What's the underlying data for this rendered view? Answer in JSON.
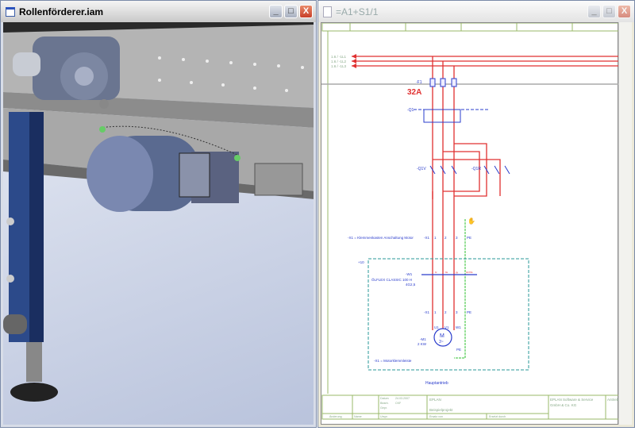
{
  "left_window": {
    "title": "Rollenförderer.iam",
    "buttons": {
      "minimize": "_",
      "maximize": "□",
      "close": "X"
    }
  },
  "right_window": {
    "title": "=A1+S1/1",
    "buttons": {
      "minimize": "_",
      "maximize": "□",
      "close": "X"
    }
  },
  "schematic": {
    "supply": [
      "1.6 / -1L1",
      "1.6 / -1L2",
      "1.6 / -1L3"
    ],
    "fuse_label": "-F1",
    "fuse_rating": "32A",
    "breaker_label": "-Q1",
    "contactor_v": "-Q1V",
    "contactor_r": "-Q1R",
    "terminal_label": "-X1",
    "terminal_desc": "-X1 = Klemmenkasten Anschaltung Motor",
    "terminals": [
      "1",
      "2",
      "3",
      "PE"
    ],
    "location": "+10",
    "cable_label": "-W1",
    "cable_type": "ÖLFLEX CLASSIC 100 H",
    "cable_size": "4G2,5",
    "cable_cores": [
      "br",
      "bk",
      "gy",
      "GNYE"
    ],
    "motor_terminals": [
      "U1",
      "V1",
      "W1",
      "PE"
    ],
    "motor_label": "-M1",
    "motor_power": "2 KW",
    "motor_symbol": "M",
    "motor_phase": "3~",
    "motor_terminal_desc": "-X1 = Motorklemmleiste",
    "caption": "Hauptantrieb"
  },
  "title_block": {
    "datum_label": "Datum",
    "datum": "24.03.2007",
    "bearb_label": "Bearb.",
    "bearb": "CKF",
    "gepr_label": "Gepr.",
    "aenderung": "Änderung",
    "name": "Name",
    "urspr": "Urspr.",
    "company_short": "EPLAN",
    "project": "Beispielprojekt",
    "ersatz": "Ersatz von",
    "ersetzt": "Ersetzt durch",
    "company": "EPLAN Software & Service",
    "company2": "GmbH & Co. KG",
    "right": "Antrieb"
  },
  "colors": {
    "power": "#e03030",
    "control": "#2a3ccc",
    "pe": "#30c030",
    "box": "#2a9a9a",
    "frame": "#9ab86a"
  }
}
